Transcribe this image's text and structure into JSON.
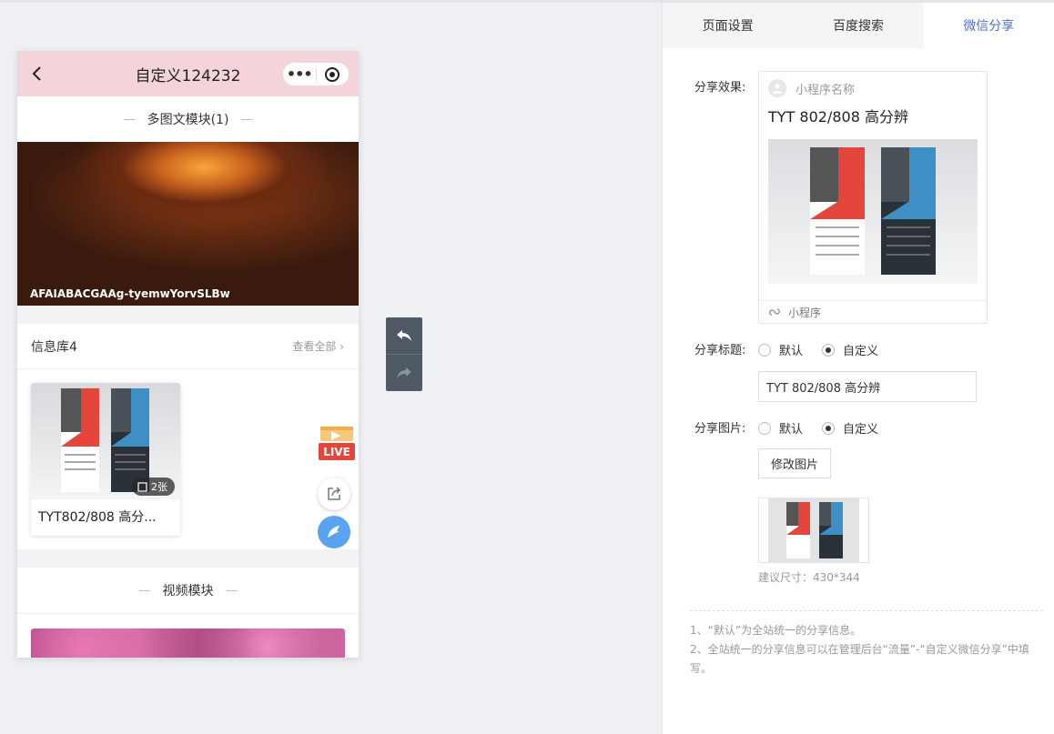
{
  "phone": {
    "nav_title": "自定义124232",
    "module1_title": "多图文模块(1)",
    "banner_caption": "AFAIABACGAAg-tyemwYorvSLBw",
    "info_title": "信息库4",
    "info_more": "查看全部",
    "card_badge": "2张",
    "card_caption": "TYT802/808 高分...",
    "live_label": "LIVE",
    "module2_title": "视频模块"
  },
  "tabs": [
    {
      "label": "页面设置"
    },
    {
      "label": "百度搜索"
    },
    {
      "label": "微信分享"
    }
  ],
  "share": {
    "effect_label": "分享效果:",
    "mini_name": "小程序名称",
    "preview_title": "TYT 802/808 高分辨",
    "footer_label": "小程序",
    "title_label": "分享标题:",
    "opt_default": "默认",
    "opt_custom": "自定义",
    "title_value": "TYT 802/808 高分辨",
    "image_label": "分享图片:",
    "modify_button": "修改图片",
    "size_hint": "建议尺寸：430*344",
    "note1": "1、“默认”为全站统一的分享信息。",
    "note2": "2、全站统一的分享信息可以在管理后台“流量”-“自定义微信分享”中填写。"
  },
  "colors": {
    "accent": "#4e6ec9",
    "nav_bg": "#f4d3da",
    "service_blue": "#5aa3f0",
    "red": "#e5463b"
  }
}
